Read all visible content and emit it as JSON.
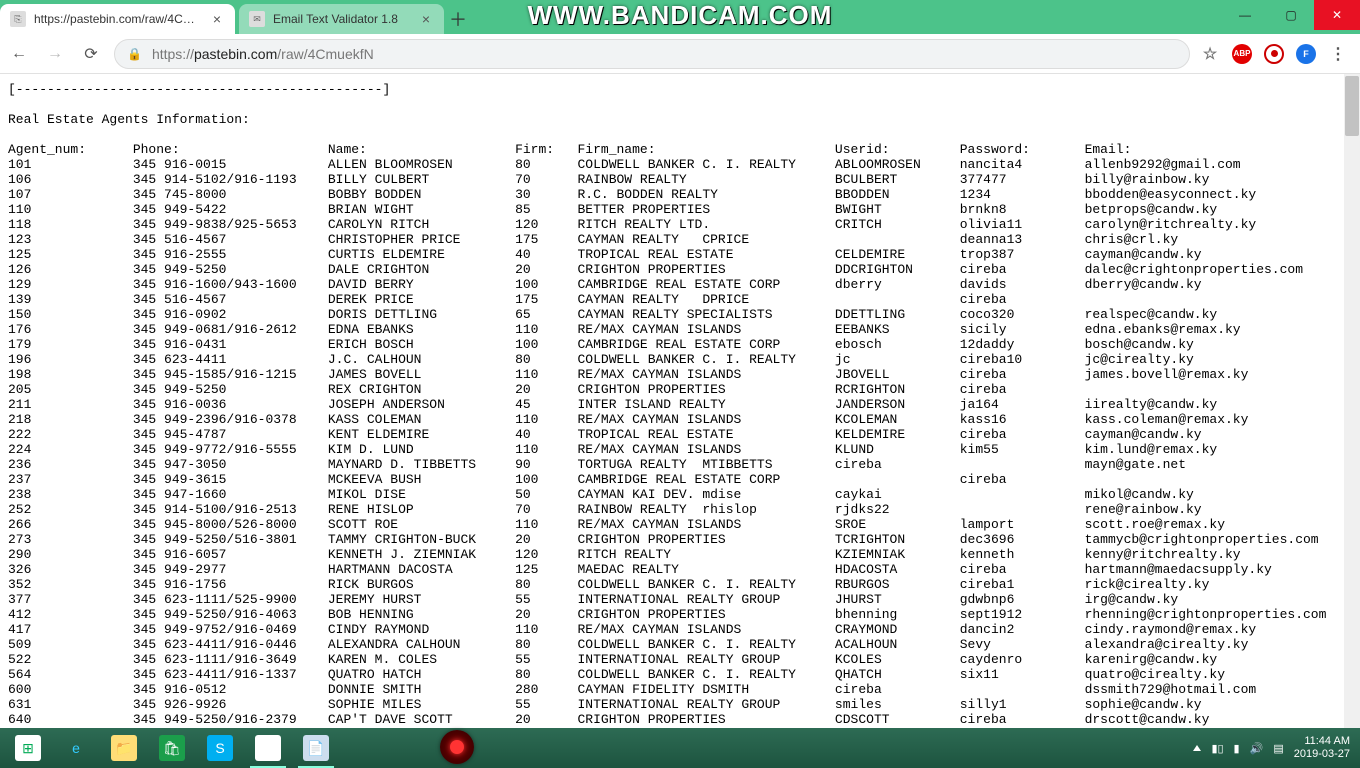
{
  "watermark": "WWW.BANDICAM.COM",
  "tabs": [
    {
      "title": "https://pastebin.com/raw/4Cmu…",
      "active": true
    },
    {
      "title": "Email Text Validator 1.8",
      "active": false
    }
  ],
  "url": {
    "scheme": "https://",
    "host": "pastebin.com",
    "path": "/raw/4CmuekfN"
  },
  "page_title_divider": "[-----------------------------------------------]",
  "page_heading": "Real Estate Agents Information:",
  "columns": [
    "Agent_num:",
    "Phone:",
    "Name:",
    "Firm:",
    "Firm_name:",
    "Userid:",
    "Password:",
    "Email:"
  ],
  "rows": [
    [
      "101",
      "345 916-0015",
      "ALLEN BLOOMROSEN",
      "80",
      "COLDWELL BANKER C. I. REALTY",
      "ABLOOMROSEN",
      "nancita4",
      "allenb9292@gmail.com"
    ],
    [
      "106",
      "345 914-5102/916-1193",
      "BILLY CULBERT",
      "70",
      "RAINBOW REALTY",
      "BCULBERT",
      "377477",
      "billy@rainbow.ky"
    ],
    [
      "107",
      "345 745-8000",
      "BOBBY BODDEN",
      "30",
      "R.C. BODDEN REALTY",
      "BBODDEN",
      "1234",
      "bbodden@easyconnect.ky"
    ],
    [
      "110",
      "345 949-5422",
      "BRIAN WIGHT",
      "85",
      "BETTER PROPERTIES",
      "BWIGHT",
      "brnkn8",
      "betprops@candw.ky"
    ],
    [
      "118",
      "345 949-9838/925-5653",
      "CAROLYN RITCH",
      "120",
      "RITCH REALTY LTD.",
      "CRITCH",
      "olivia11",
      "carolyn@ritchrealty.ky"
    ],
    [
      "123",
      "345 516-4567",
      "CHRISTOPHER PRICE",
      "175",
      "CAYMAN REALTY   CPRICE",
      "",
      "deanna13",
      "chris@crl.ky"
    ],
    [
      "125",
      "345 916-2555",
      "CURTIS ELDEMIRE",
      "40",
      "TROPICAL REAL ESTATE",
      "CELDEMIRE",
      "trop387",
      "cayman@candw.ky"
    ],
    [
      "126",
      "345 949-5250",
      "DALE CRIGHTON",
      "20",
      "CRIGHTON PROPERTIES",
      "DDCRIGHTON",
      "cireba",
      "dalec@crightonproperties.com"
    ],
    [
      "129",
      "345 916-1600/943-1600",
      "DAVID BERRY",
      "100",
      "CAMBRIDGE REAL ESTATE CORP",
      "dberry",
      "davids",
      "dberry@candw.ky"
    ],
    [
      "139",
      "345 516-4567",
      "DEREK PRICE",
      "175",
      "CAYMAN REALTY   DPRICE",
      "",
      "cireba",
      ""
    ],
    [
      "150",
      "345 916-0902",
      "DORIS DETTLING",
      "65",
      "CAYMAN REALTY SPECIALISTS",
      "DDETTLING",
      "coco320",
      "realspec@candw.ky"
    ],
    [
      "176",
      "345 949-0681/916-2612",
      "EDNA EBANKS",
      "110",
      "RE/MAX CAYMAN ISLANDS",
      "EEBANKS",
      "sicily",
      "edna.ebanks@remax.ky"
    ],
    [
      "179",
      "345 916-0431",
      "ERICH BOSCH",
      "100",
      "CAMBRIDGE REAL ESTATE CORP",
      "ebosch",
      "12daddy",
      "bosch@candw.ky"
    ],
    [
      "196",
      "345 623-4411",
      "J.C. CALHOUN",
      "80",
      "COLDWELL BANKER C. I. REALTY",
      "jc",
      "cireba10",
      "jc@cirealty.ky"
    ],
    [
      "198",
      "345 945-1585/916-1215",
      "JAMES BOVELL",
      "110",
      "RE/MAX CAYMAN ISLANDS",
      "JBOVELL",
      "cireba",
      "james.bovell@remax.ky"
    ],
    [
      "205",
      "345 949-5250",
      "REX CRIGHTON",
      "20",
      "CRIGHTON PROPERTIES",
      "RCRIGHTON",
      "cireba",
      ""
    ],
    [
      "211",
      "345 916-0036",
      "JOSEPH ANDERSON",
      "45",
      "INTER ISLAND REALTY",
      "JANDERSON",
      "ja164",
      "iirealty@candw.ky"
    ],
    [
      "218",
      "345 949-2396/916-0378",
      "KASS COLEMAN",
      "110",
      "RE/MAX CAYMAN ISLANDS",
      "KCOLEMAN",
      "kass16",
      "kass.coleman@remax.ky"
    ],
    [
      "222",
      "345 945-4787",
      "KENT ELDEMIRE",
      "40",
      "TROPICAL REAL ESTATE",
      "KELDEMIRE",
      "cireba",
      "cayman@candw.ky"
    ],
    [
      "224",
      "345 949-9772/916-5555",
      "KIM D. LUND",
      "110",
      "RE/MAX CAYMAN ISLANDS",
      "KLUND",
      "kim55",
      "kim.lund@remax.ky"
    ],
    [
      "236",
      "345 947-3050",
      "MAYNARD D. TIBBETTS",
      "90",
      "TORTUGA REALTY  MTIBBETTS",
      "cireba",
      "",
      "mayn@gate.net"
    ],
    [
      "237",
      "345 949-3615",
      "MCKEEVA BUSH",
      "100",
      "CAMBRIDGE REAL ESTATE CORP",
      "",
      "cireba",
      ""
    ],
    [
      "238",
      "345 947-1660",
      "MIKOL DISE",
      "50",
      "CAYMAN KAI DEV. mdise",
      "caykai",
      "",
      "mikol@candw.ky"
    ],
    [
      "252",
      "345 914-5100/916-2513",
      "RENE HISLOP",
      "70",
      "RAINBOW REALTY  rhislop",
      "rjdks22",
      "",
      "rene@rainbow.ky"
    ],
    [
      "266",
      "345 945-8000/526-8000",
      "SCOTT ROE",
      "110",
      "RE/MAX CAYMAN ISLANDS",
      "SROE",
      "lamport",
      "scott.roe@remax.ky"
    ],
    [
      "273",
      "345 949-5250/516-3801",
      "TAMMY CRIGHTON-BUCK",
      "20",
      "CRIGHTON PROPERTIES",
      "TCRIGHTON",
      "dec3696",
      "tammycb@crightonproperties.com"
    ],
    [
      "290",
      "345 916-6057",
      "KENNETH J. ZIEMNIAK",
      "120",
      "RITCH REALTY",
      "KZIEMNIAK",
      "kenneth",
      "kenny@ritchrealty.ky"
    ],
    [
      "326",
      "345 949-2977",
      "HARTMANN DACOSTA",
      "125",
      "MAEDAC REALTY",
      "HDACOSTA",
      "cireba",
      "hartmann@maedacsupply.ky"
    ],
    [
      "352",
      "345 916-1756",
      "RICK BURGOS",
      "80",
      "COLDWELL BANKER C. I. REALTY",
      "RBURGOS",
      "cireba1",
      "rick@cirealty.ky"
    ],
    [
      "377",
      "345 623-1111/525-9900",
      "JEREMY HURST",
      "55",
      "INTERNATIONAL REALTY GROUP",
      "JHURST",
      "gdwbnp6",
      "irg@candw.ky"
    ],
    [
      "412",
      "345 949-5250/916-4063",
      "BOB HENNING",
      "20",
      "CRIGHTON PROPERTIES",
      "bhenning",
      "sept1912",
      "rhenning@crightonproperties.com"
    ],
    [
      "417",
      "345 949-9752/916-0469",
      "CINDY RAYMOND",
      "110",
      "RE/MAX CAYMAN ISLANDS",
      "CRAYMOND",
      "dancin2",
      "cindy.raymond@remax.ky"
    ],
    [
      "509",
      "345 623-4411/916-0446",
      "ALEXANDRA CALHOUN",
      "80",
      "COLDWELL BANKER C. I. REALTY",
      "ACALHOUN",
      "Sevy",
      "alexandra@cirealty.ky"
    ],
    [
      "522",
      "345 623-1111/916-3649",
      "KAREN M. COLES",
      "55",
      "INTERNATIONAL REALTY GROUP",
      "KCOLES",
      "caydenro",
      "karenirg@candw.ky"
    ],
    [
      "564",
      "345 623-4411/916-1337",
      "QUATRO HATCH",
      "80",
      "COLDWELL BANKER C. I. REALTY",
      "QHATCH",
      "six11",
      "quatro@cirealty.ky"
    ],
    [
      "600",
      "345 916-0512",
      "DONNIE SMITH",
      "280",
      "CAYMAN FIDELITY DSMITH",
      "cireba",
      "",
      "dssmith729@hotmail.com"
    ],
    [
      "631",
      "345 926-9926",
      "SOPHIE MILES",
      "55",
      "INTERNATIONAL REALTY GROUP",
      "smiles",
      "silly1",
      "sophie@candw.ky"
    ],
    [
      "640",
      "345 949-5250/916-2379",
      "CAP'T DAVE SCOTT",
      "20",
      "CRIGHTON PROPERTIES",
      "CDSCOTT",
      "cireba",
      "drscott@candw.ky"
    ]
  ],
  "tray": {
    "time": "11:44 AM",
    "date": "2019-03-27"
  },
  "taskbar_apps": [
    "start",
    "ie",
    "explorer",
    "store",
    "skype",
    "chrome",
    "notepad"
  ],
  "avatar_letter": "F"
}
